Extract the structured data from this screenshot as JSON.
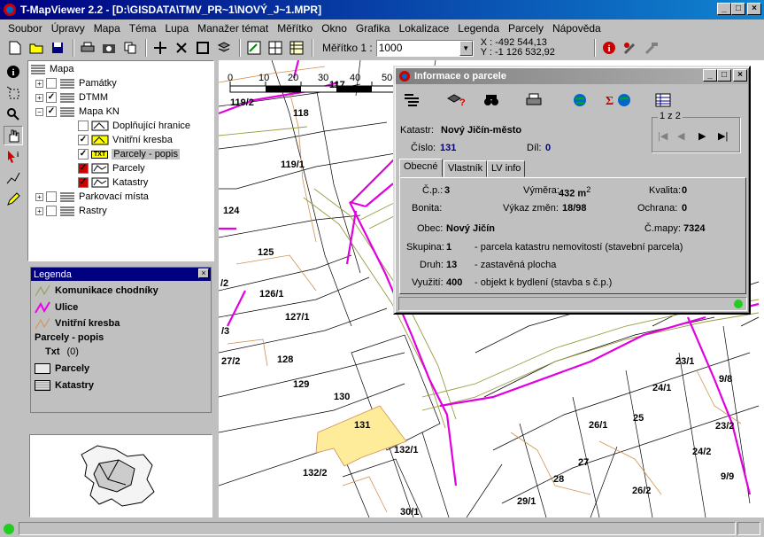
{
  "window": {
    "title": "T-MapViewer 2.2 - [D:\\GISDATA\\TMV_PR~1\\NOVÝ_J~1.MPR]",
    "min": "_",
    "max": "□",
    "close": "×"
  },
  "menu": [
    "Soubor",
    "Úpravy",
    "Mapa",
    "Téma",
    "Lupa",
    "Manažer témat",
    "Měřítko",
    "Okno",
    "Grafika",
    "Lokalizace",
    "Legenda",
    "Parcely",
    "Nápověda"
  ],
  "toolbar": {
    "scale_label": "Měřítko 1 :",
    "scale_value": "1000",
    "coord_x": "X : -492 544,13",
    "coord_y": "Y : -1 126 532,92"
  },
  "tree": {
    "root": "Mapa",
    "items": [
      {
        "label": "Památky",
        "checked": false
      },
      {
        "label": "DTMM",
        "checked": true
      },
      {
        "label": "Mapa KN",
        "checked": true
      },
      {
        "label": "Doplňující hranice",
        "checked": false
      },
      {
        "label": "Vnitřní kresba",
        "checked": true
      },
      {
        "label": "Parcely - popis",
        "checked": true
      },
      {
        "label": "Parcely",
        "checked": true
      },
      {
        "label": "Katastry",
        "checked": true
      },
      {
        "label": "Parkovací místa",
        "checked": false
      },
      {
        "label": "Rastry",
        "checked": false
      }
    ],
    "txt_badge": "TXT"
  },
  "legend": {
    "title": "Legenda",
    "close": "×",
    "items": [
      "Komunikace chodníky",
      "Ulice",
      "Vnitřní kresba",
      "Parcely - popis",
      "Txt",
      "(0)",
      "Parcely",
      "Katastry"
    ]
  },
  "map": {
    "scale_ticks": [
      "0",
      "10",
      "20",
      "30",
      "40",
      "50"
    ],
    "parcels": [
      "119/2",
      "118",
      "117",
      "119/1",
      "124",
      "125",
      "126/1",
      "127/1",
      "128",
      "129",
      "130",
      "131",
      "132/1",
      "132/2",
      "30/1",
      "27/2",
      "/3",
      "/2",
      "23/1",
      "24/1",
      "25",
      "26/1",
      "27",
      "28",
      "26/2",
      "29/1",
      "23/2",
      "24/2",
      "9/9",
      "9/8"
    ]
  },
  "info": {
    "title": "Informace o parcele",
    "katastr_label": "Katastr:",
    "katastr_value": "Nový Jičín-město",
    "cislo_label": "Číslo:",
    "cislo_value": "131",
    "dil_label": "Díl:",
    "dil_value": "0",
    "nav_label": "1 z 2",
    "tabs": [
      "Obecné",
      "Vlastník",
      "LV info"
    ],
    "cp_label": "Č.p.:",
    "cp_value": "3",
    "vymera_label": "Výměra:",
    "vymera_value": "432 m",
    "vymera_sup": "2",
    "kvalita_label": "Kvalita:",
    "kvalita_value": "0",
    "bonita_label": "Bonita:",
    "vykaz_label": "Výkaz změn:",
    "vykaz_value": "18/98",
    "ochrana_label": "Ochrana:",
    "ochrana_value": "0",
    "obec_label": "Obec:",
    "obec_value": "Nový Jičín",
    "cmapy_label": "Č.mapy:",
    "cmapy_value": "7324",
    "skupina_label": "Skupina:",
    "skupina_value": "1",
    "skupina_desc": "- parcela katastru nemovitostí (stavební parcela)",
    "druh_label": "Druh:",
    "druh_value": "13",
    "druh_desc": "- zastavěná plocha",
    "vyuziti_label": "Využití:",
    "vyuziti_value": "400",
    "vyuziti_desc": "- objekt k bydlení (stavba s č.p.)"
  }
}
